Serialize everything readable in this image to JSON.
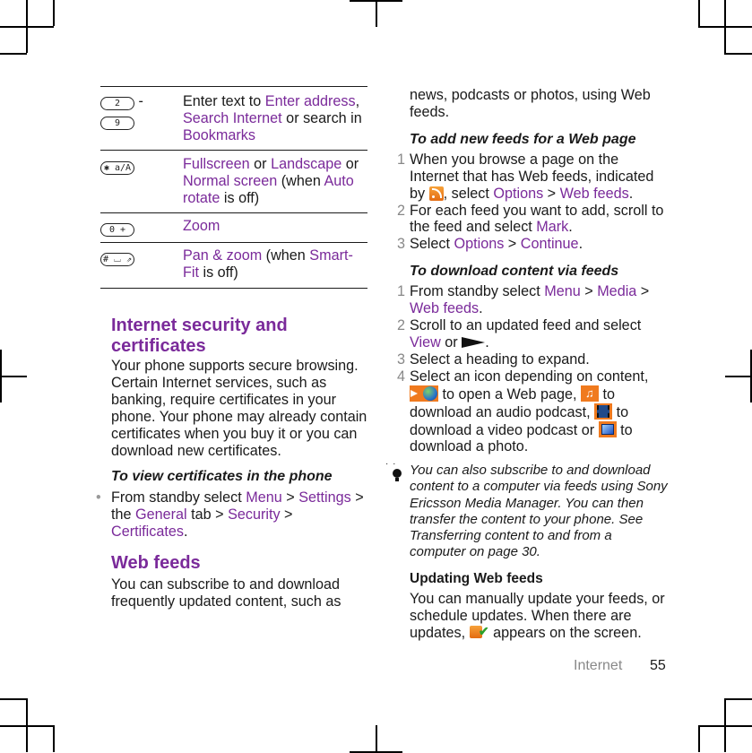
{
  "key_table": {
    "rows": [
      {
        "keys": [
          "2",
          "9"
        ],
        "key_separator": "-",
        "parts": [
          {
            "t": "Enter text to ",
            "h": false
          },
          {
            "t": "Enter address",
            "h": true
          },
          {
            "t": ", ",
            "h": false
          },
          {
            "t": "Search Internet",
            "h": true
          },
          {
            "t": " or search in ",
            "h": false
          },
          {
            "t": "Bookmarks",
            "h": true
          }
        ]
      },
      {
        "keys": [
          "✱ a/A"
        ],
        "parts": [
          {
            "t": "Fullscreen",
            "h": true
          },
          {
            "t": " or ",
            "h": false
          },
          {
            "t": "Landscape",
            "h": true
          },
          {
            "t": " or ",
            "h": false
          },
          {
            "t": "Normal screen",
            "h": true
          },
          {
            "t": " (when ",
            "h": false
          },
          {
            "t": "Auto rotate",
            "h": true
          },
          {
            "t": " is off)",
            "h": false
          }
        ]
      },
      {
        "keys": [
          "0 +"
        ],
        "parts": [
          {
            "t": "Zoom",
            "h": true
          }
        ]
      },
      {
        "keys": [
          "# ⌴ ⇗"
        ],
        "parts": [
          {
            "t": "Pan & zoom",
            "h": true
          },
          {
            "t": " (when ",
            "h": false
          },
          {
            "t": "Smart-Fit",
            "h": true
          },
          {
            "t": " is off)",
            "h": false
          }
        ]
      }
    ]
  },
  "security": {
    "heading": "Internet security and certificates",
    "body": "Your phone supports secure browsing. Certain Internet services, such as banking, require certificates in your phone. Your phone may already contain certificates when you buy it or you can download new certificates.",
    "subheading": "To view certificates in the phone",
    "bullet": {
      "b1": "From standby select ",
      "m1": "Menu",
      "b2": " > ",
      "m2": "Settings",
      "b3": " > the ",
      "m3": "General",
      "b4": " tab > ",
      "m4": "Security",
      "b5": " > ",
      "m5": "Certificates",
      "b6": "."
    }
  },
  "web_feeds": {
    "heading": "Web feeds",
    "intro": "You can subscribe to and download frequently updated content, such as news, podcasts or photos, using Web feeds.",
    "intro_part1": "You can subscribe to and download frequently updated content, such as",
    "intro_part2": "news, podcasts or photos, using Web feeds.",
    "add": {
      "subheading": "To add new feeds for a Web page",
      "steps": [
        {
          "n": "1",
          "a": "When you browse a page on the Internet that has Web feeds, indicated by ",
          "icon": "rss-feed-icon",
          "b": ", select ",
          "m1": "Options",
          "c": " > ",
          "m2": "Web feeds",
          "d": "."
        },
        {
          "n": "2",
          "a": "For each feed you want to add, scroll to the feed and select ",
          "m1": "Mark",
          "b": "."
        },
        {
          "n": "3",
          "a": "Select ",
          "m1": "Options",
          "b": " > ",
          "m2": "Continue",
          "c": "."
        }
      ]
    },
    "download": {
      "subheading": "To download content via feeds",
      "steps": [
        {
          "n": "1",
          "a": "From standby select ",
          "m1": "Menu",
          "b": " > ",
          "m2": "Media",
          "c": " > ",
          "m3": "Web feeds",
          "d": "."
        },
        {
          "n": "2",
          "a": "Scroll to an updated feed and select ",
          "m1": "View",
          "b": " or ",
          "icon": "play-icon",
          "c": "."
        },
        {
          "n": "3",
          "a": "Select a heading to expand."
        },
        {
          "n": "4",
          "a": "Select an icon depending on content, ",
          "i1": " to open a Web page, ",
          "i2": " to download an audio podcast, ",
          "i3": " to download a video podcast or ",
          "i4": " to download a photo."
        }
      ]
    },
    "tip": "You can also subscribe to and download content to a computer via feeds using Sony Ericsson Media Manager. You can then transfer the content to your phone. See Transferring content to and from a computer on page 30.",
    "updating": {
      "subheading": "Updating Web feeds",
      "body_a": "You can manually update your feeds, or schedule updates. When there are updates, ",
      "body_b": " appears on the screen."
    }
  },
  "footer": {
    "section": "Internet",
    "page": "55"
  },
  "colors": {
    "highlight": "#7a2a9a",
    "text": "#1a1a1a",
    "step_number": "#888888",
    "icon_orange": "#f07a1e"
  }
}
